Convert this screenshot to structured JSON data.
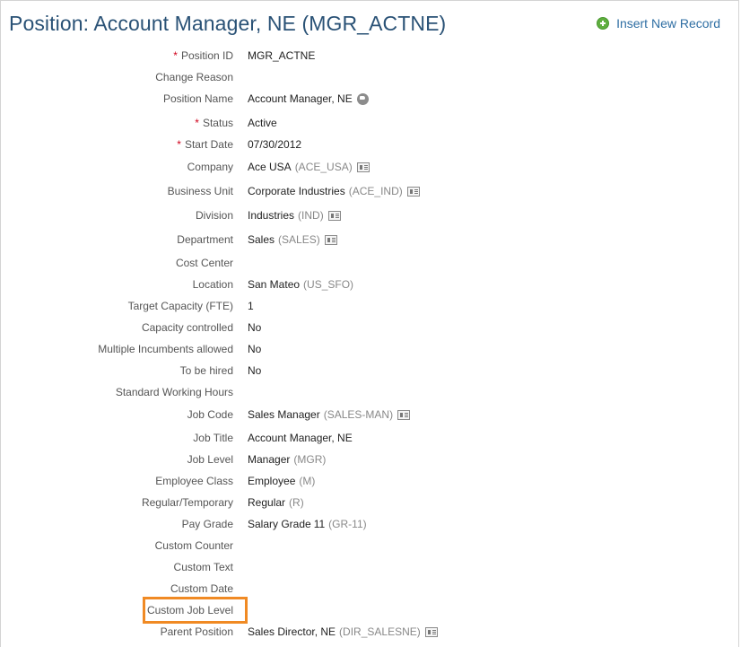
{
  "header": {
    "title": "Position: Account Manager, NE (MGR_ACTNE)",
    "insert_label": "Insert New Record"
  },
  "fields": {
    "position_id": {
      "label": "Position ID",
      "required": "*",
      "value": "MGR_ACTNE"
    },
    "change_reason": {
      "label": "Change Reason"
    },
    "position_name": {
      "label": "Position Name",
      "value": "Account Manager, NE"
    },
    "status": {
      "label": "Status",
      "required": "*",
      "value": "Active"
    },
    "start_date": {
      "label": "Start Date",
      "required": "*",
      "value": "07/30/2012"
    },
    "company": {
      "label": "Company",
      "value": "Ace USA",
      "code": "(ACE_USA)"
    },
    "business_unit": {
      "label": "Business Unit",
      "value": "Corporate Industries",
      "code": "(ACE_IND)"
    },
    "division": {
      "label": "Division",
      "value": "Industries",
      "code": "(IND)"
    },
    "department": {
      "label": "Department",
      "value": "Sales",
      "code": "(SALES)"
    },
    "cost_center": {
      "label": "Cost Center"
    },
    "location": {
      "label": "Location",
      "value": "San Mateo",
      "code": "(US_SFO)"
    },
    "target_capacity": {
      "label": "Target Capacity (FTE)",
      "value": "1"
    },
    "capacity_controlled": {
      "label": "Capacity controlled",
      "value": "No"
    },
    "multiple_incumbents": {
      "label": "Multiple Incumbents allowed",
      "value": "No"
    },
    "to_be_hired": {
      "label": "To be hired",
      "value": "No"
    },
    "standard_working_hours": {
      "label": "Standard Working Hours"
    },
    "job_code": {
      "label": "Job Code",
      "value": "Sales Manager",
      "code": "(SALES-MAN)"
    },
    "job_title": {
      "label": "Job Title",
      "value": "Account Manager, NE"
    },
    "job_level": {
      "label": "Job Level",
      "value": "Manager",
      "code": "(MGR)"
    },
    "employee_class": {
      "label": "Employee Class",
      "value": "Employee",
      "code": "(M)"
    },
    "regular_temporary": {
      "label": "Regular/Temporary",
      "value": "Regular",
      "code": "(R)"
    },
    "pay_grade": {
      "label": "Pay Grade",
      "value": "Salary Grade",
      "num": "11",
      "code": "(GR-11)"
    },
    "custom_counter": {
      "label": "Custom Counter"
    },
    "custom_text": {
      "label": "Custom Text"
    },
    "custom_date": {
      "label": "Custom Date"
    },
    "custom_job_level": {
      "label": "Custom Job Level"
    },
    "parent_position": {
      "label": "Parent Position",
      "value": "Sales Director, NE",
      "code": "(DIR_SALESNE)"
    }
  },
  "icons": {
    "add": "plus-circle-icon",
    "detail": "detail-card-icon",
    "translate": "globe-icon"
  },
  "colors": {
    "title": "#2a5276",
    "link": "#2e6ea3",
    "required": "#d0021b",
    "highlight": "#f08a24",
    "add_icon": "#5fae3f"
  }
}
